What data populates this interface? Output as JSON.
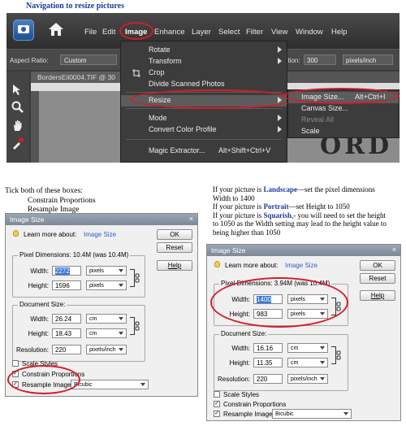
{
  "heading": "Navigation to resize pictures",
  "pse": {
    "menu": [
      "File",
      "Edit",
      "Image",
      "Enhance",
      "Layer",
      "Select",
      "Filter",
      "View",
      "Window",
      "Help"
    ],
    "aspect_label": "Aspect Ratio:",
    "aspect_value": "Custom",
    "resolution_label": "ution:",
    "resolution_value": "300",
    "resolution_unit": "pixels/inch",
    "doc_tab": "BordersEil0004.TIF @ 30",
    "image_menu": {
      "rotate": "Rotate",
      "transform": "Transform",
      "crop": "Crop",
      "divide": "Divide Scanned Photos",
      "resize": "Resize",
      "mode": "Mode",
      "convert": "Convert Color Profile",
      "magic": "Magic Extractor...",
      "magic_shortcut": "Alt+Shift+Ctrl+V"
    },
    "resize_menu": {
      "image_size": "Image Size...",
      "image_size_shortcut": "Alt+Ctrl+I",
      "canvas_size": "Canvas Size...",
      "reveal_all": "Reveal All",
      "scale": "Scale"
    },
    "canvas_text": "ORD"
  },
  "left_note": {
    "line1": "Tick both of these boxes:",
    "line2": "Constrain Proportions",
    "line3": "Resample Image"
  },
  "right_note": {
    "l1a": "If your picture is ",
    "l1b": "Landscape",
    "l1c": "—set the pixel dimensions",
    "l2": "Width to 1400",
    "l3a": "If your picture is ",
    "l3b": "Portrait",
    "l3c": "—set Height to 1050",
    "l4a": "If your picture is ",
    "l4b": "Squarish",
    "l4c": ",- you will need to set the height",
    "l5": "to 1050 as the Width setting may lead to the height value to",
    "l6": "being higher than 1050"
  },
  "dialog_left": {
    "title": "Image Size",
    "close": "×",
    "learn": "Learn more about:",
    "learn_link": "Image Size",
    "ok": "OK",
    "reset": "Reset",
    "help": "Help",
    "pixel_dims": "Pixel Dimensions: 10.4M (was 10.4M)",
    "width_label": "Width:",
    "width_value": "2272",
    "height_label": "Height:",
    "height_value": "1596",
    "pixels": "pixels",
    "doc_size": "Document Size:",
    "doc_width": "26.24",
    "doc_height": "18.43",
    "cm": "cm",
    "resolution_label": "Resolution:",
    "resolution_value": "220",
    "resolution_unit": "pixels/inch",
    "scale_styles": "Scale Styles",
    "constrain": "Constrain Proportions",
    "resample": "Resample Image:",
    "resample_value": "Bicubic",
    "check": "✓"
  },
  "dialog_right": {
    "title": "Image Size",
    "close": "×",
    "learn": "Learn more about:",
    "learn_link": "Image Size",
    "ok": "OK",
    "reset": "Reset",
    "help": "Help",
    "pixel_dims": "Pixel Dimensions: 3.94M (was 10.4M)",
    "width_label": "Width:",
    "width_value": "1400",
    "height_label": "Height:",
    "height_value": "983",
    "pixels": "pixels",
    "doc_size": "Document Size:",
    "doc_width": "16.16",
    "doc_height": "11.35",
    "cm": "cm",
    "resolution_label": "Resolution:",
    "resolution_value": "220",
    "resolution_unit": "pixels/inch",
    "scale_styles": "Scale Styles",
    "constrain": "Constrain Proportions",
    "resample": "Resample Image:",
    "resample_value": "Bicubic",
    "check": "✓"
  },
  "colors": {
    "annotation": "#d41c2b",
    "heading": "#1a3a99",
    "link": "#2b5fc7"
  }
}
